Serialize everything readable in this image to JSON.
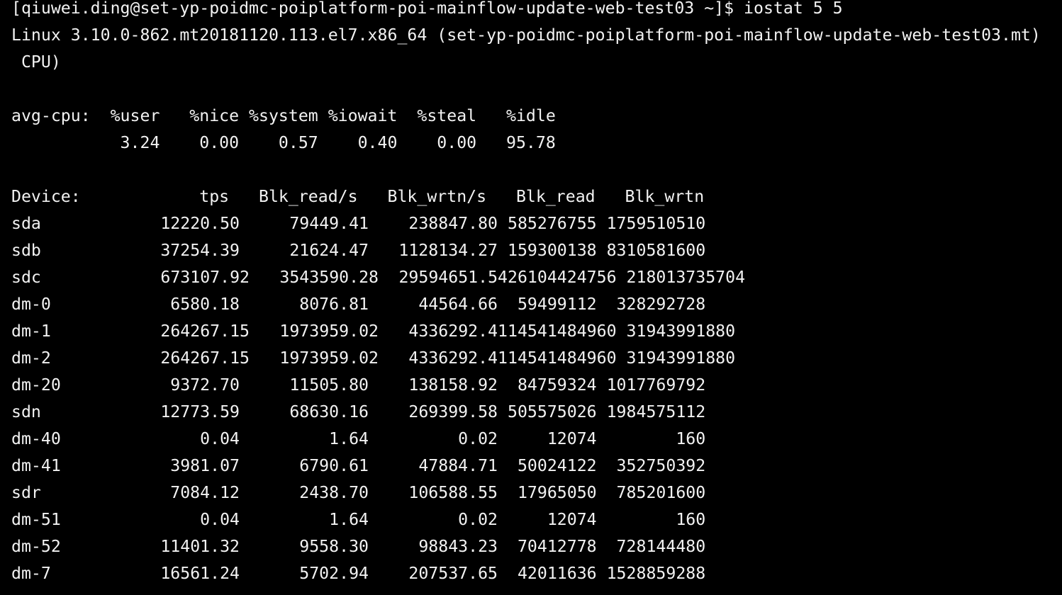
{
  "terminal": {
    "prompt_line": "[qiuwei.ding@set-yp-poidmc-poiplatform-poi-mainflow-update-web-test03 ~]$ iostat 5 5",
    "kernel_line": "Linux 3.10.0-862.mt20181120.113.el7.x86_64 (set-yp-poidmc-poiplatform-poi-mainflow-update-web-test03.mt)",
    "cpu_count_line": " CPU)",
    "cpu_header": "avg-cpu:  %user   %nice %system %iowait  %steal   %idle",
    "cpu_values": "           3.24    0.00    0.57    0.40    0.00   95.78",
    "device_header": "Device:            tps   Blk_read/s   Blk_wrtn/s   Blk_read   Blk_wrtn",
    "rows": [
      {
        "device": "sda",
        "tps": "12220.50",
        "blk_read_s": "79449.41",
        "blk_wrtn_s": "238847.80",
        "rest": "585276755 1759510510"
      },
      {
        "device": "sdb",
        "tps": "37254.39",
        "blk_read_s": "21624.47",
        "blk_wrtn_s": "1128134.27",
        "rest": "159300138 8310581600"
      },
      {
        "device": "sdc",
        "tps": "673107.92",
        "blk_read_s": "3543590.28",
        "blk_wrtn_s": "29594651.54",
        "rest": "26104424756 218013735704"
      },
      {
        "device": "dm-0",
        "tps": "6580.18",
        "blk_read_s": "8076.81",
        "blk_wrtn_s": "44564.66",
        "rest": " 59499112  328292728"
      },
      {
        "device": "dm-1",
        "tps": "264267.15",
        "blk_read_s": "1973959.02",
        "blk_wrtn_s": "4336292.41",
        "rest": "14541484960 31943991880"
      },
      {
        "device": "dm-2",
        "tps": "264267.15",
        "blk_read_s": "1973959.02",
        "blk_wrtn_s": "4336292.41",
        "rest": "14541484960 31943991880"
      },
      {
        "device": "dm-20",
        "tps": "9372.70",
        "blk_read_s": "11505.80",
        "blk_wrtn_s": "138158.92",
        "rest": " 84759324 1017769792"
      },
      {
        "device": "sdn",
        "tps": "12773.59",
        "blk_read_s": "68630.16",
        "blk_wrtn_s": "269399.58",
        "rest": "505575026 1984575112"
      },
      {
        "device": "dm-40",
        "tps": "0.04",
        "blk_read_s": "1.64",
        "blk_wrtn_s": "0.02",
        "rest": "    12074        160"
      },
      {
        "device": "dm-41",
        "tps": "3981.07",
        "blk_read_s": "6790.61",
        "blk_wrtn_s": "47884.71",
        "rest": " 50024122  352750392"
      },
      {
        "device": "sdr",
        "tps": "7084.12",
        "blk_read_s": "2438.70",
        "blk_wrtn_s": "106588.55",
        "rest": " 17965050  785201600"
      },
      {
        "device": "dm-51",
        "tps": "0.04",
        "blk_read_s": "1.64",
        "blk_wrtn_s": "0.02",
        "rest": "    12074        160"
      },
      {
        "device": "dm-52",
        "tps": "11401.32",
        "blk_read_s": "9558.30",
        "blk_wrtn_s": "98843.23",
        "rest": " 70412778  728144480"
      },
      {
        "device": "dm-7",
        "tps": "16561.24",
        "blk_read_s": "5702.94",
        "blk_wrtn_s": "207537.65",
        "rest": " 42011636 1528859288"
      }
    ]
  },
  "colors": {
    "background": "#000000",
    "foreground": "#f2f2f2"
  }
}
